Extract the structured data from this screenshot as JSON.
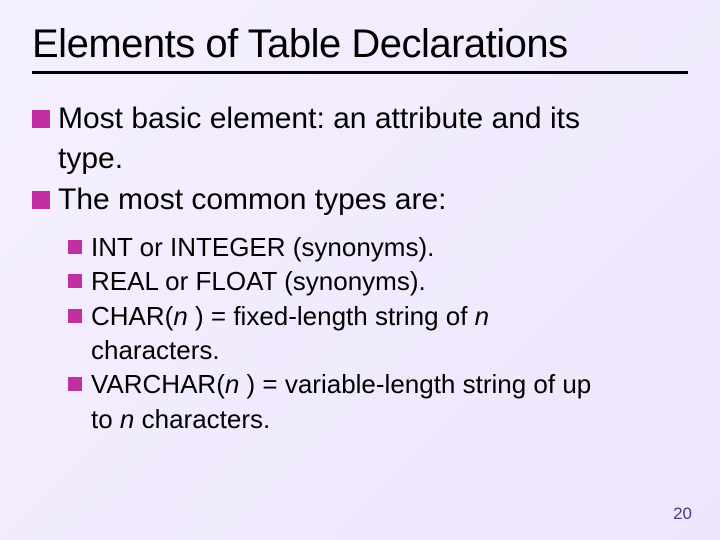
{
  "title": "Elements of Table Declarations",
  "bullets": {
    "b1_line1": "Most basic element: an attribute and its",
    "b1_line2": "type.",
    "b2": "The most common types are:"
  },
  "subs": {
    "s1": "INT or INTEGER (synonyms).",
    "s2": "REAL or FLOAT (synonyms).",
    "s3_pre": "CHAR(",
    "s3_n": "n ",
    "s3_post": ") = fixed-length string of ",
    "s3_n2": "n",
    "s3_line2": "characters.",
    "s4_pre": "VARCHAR(",
    "s4_n": "n ",
    "s4_post": ") = variable-length string of up",
    "s4_line2a": "to ",
    "s4_line2n": "n ",
    "s4_line2b": " characters."
  },
  "page_number": "20"
}
